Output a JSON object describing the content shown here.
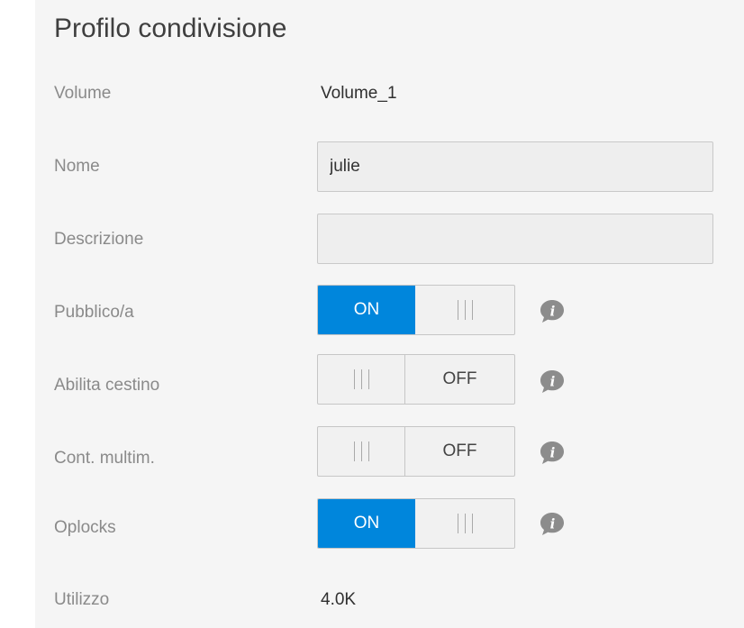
{
  "title": "Profilo condivisione",
  "fields": {
    "volume": {
      "label": "Volume",
      "value": "Volume_1"
    },
    "name": {
      "label": "Nome",
      "value": "julie",
      "placeholder": ""
    },
    "description": {
      "label": "Descrizione",
      "value": "",
      "placeholder": ""
    },
    "public": {
      "label": "Pubblico/a",
      "state": "on",
      "state_text": "ON"
    },
    "recycle_bin": {
      "label": "Abilita cestino",
      "state": "off",
      "state_text": "OFF"
    },
    "media": {
      "label": "Cont. multim.",
      "state": "off",
      "state_text": "OFF"
    },
    "oplocks": {
      "label": "Oplocks",
      "state": "on",
      "state_text": "ON"
    },
    "usage": {
      "label": "Utilizzo",
      "value": "4.0K"
    }
  },
  "icons": {
    "info": "info-icon"
  },
  "colors": {
    "toggle_on": "#0086dc",
    "panel_bg": "#f5f5f5",
    "info_icon": "#8c8c8c"
  }
}
